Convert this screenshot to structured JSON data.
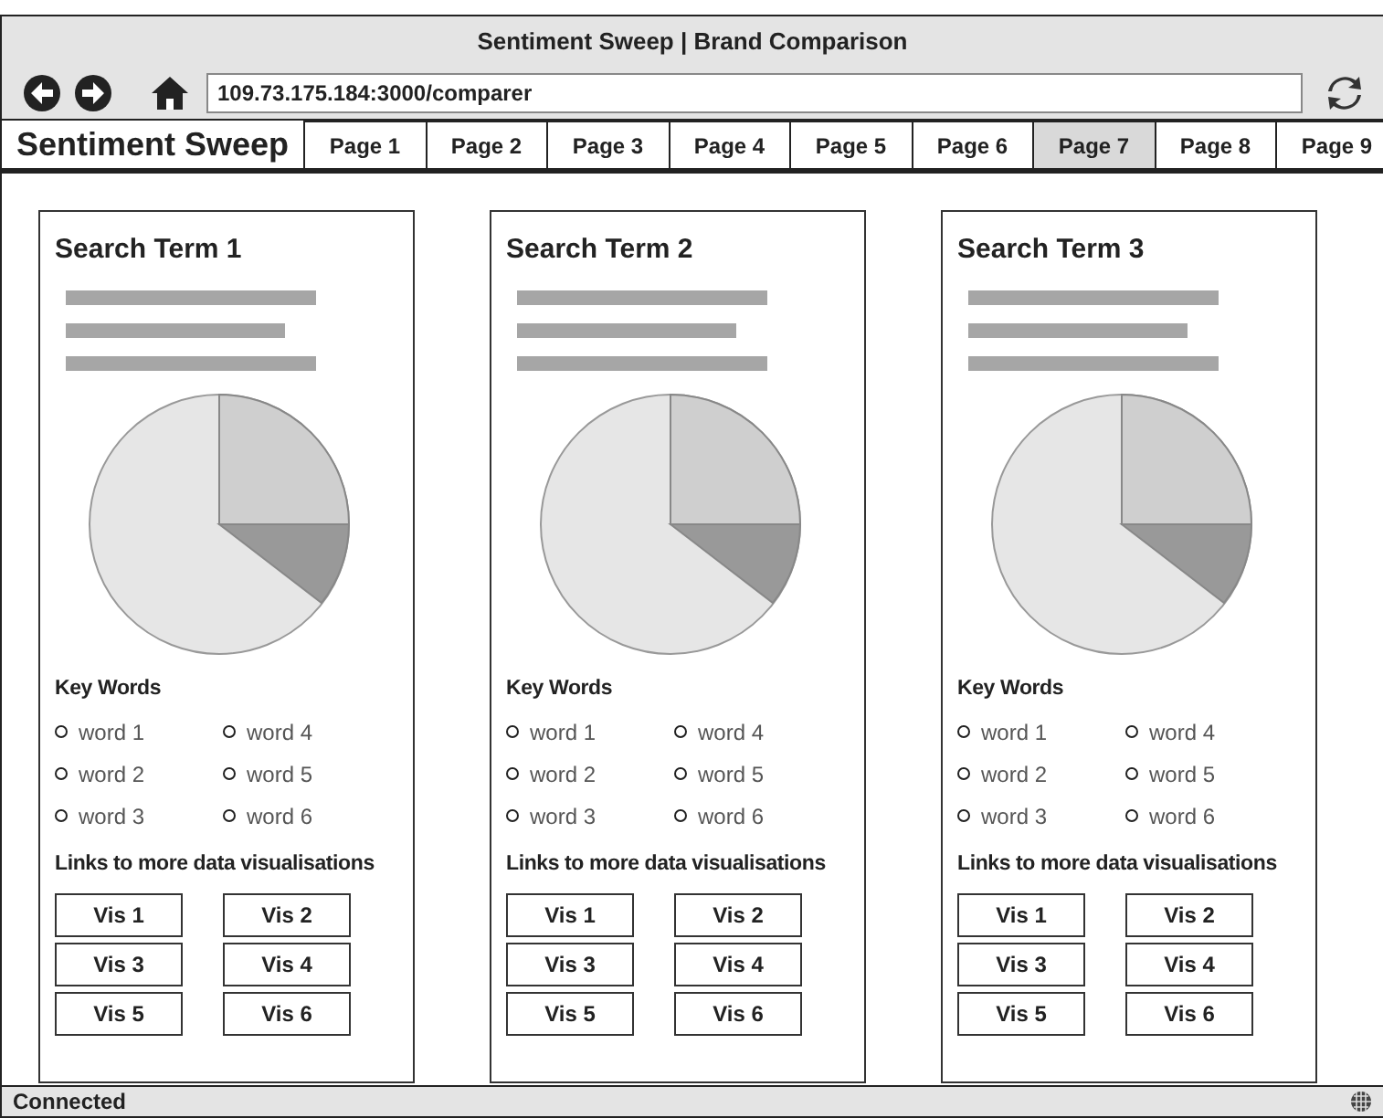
{
  "window": {
    "title": "Sentiment Sweep | Brand Comparison"
  },
  "address_bar": {
    "value": "109.73.175.184:3000/comparer"
  },
  "brand": "Sentiment Sweep",
  "tabs": [
    {
      "label": "Page 1",
      "selected": false
    },
    {
      "label": "Page 2",
      "selected": false
    },
    {
      "label": "Page 3",
      "selected": false
    },
    {
      "label": "Page 4",
      "selected": false
    },
    {
      "label": "Page 5",
      "selected": false
    },
    {
      "label": "Page 6",
      "selected": false
    },
    {
      "label": "Page 7",
      "selected": true
    },
    {
      "label": "Page 8",
      "selected": false
    },
    {
      "label": "Page 9",
      "selected": false
    }
  ],
  "cards": [
    {
      "title": "Search Term 1",
      "key_words_heading": "Key Words",
      "key_words": [
        "word 1",
        "word 2",
        "word 3",
        "word 4",
        "word 5",
        "word 6"
      ],
      "links_heading": "Links to more data visualisations",
      "links": [
        "Vis 1",
        "Vis 2",
        "Vis 3",
        "Vis 4",
        "Vis 5",
        "Vis 6"
      ]
    },
    {
      "title": "Search Term 2",
      "key_words_heading": "Key Words",
      "key_words": [
        "word 1",
        "word 2",
        "word 3",
        "word 4",
        "word 5",
        "word 6"
      ],
      "links_heading": "Links to more data visualisations",
      "links": [
        "Vis 1",
        "Vis 2",
        "Vis 3",
        "Vis 4",
        "Vis 5",
        "Vis 6"
      ]
    },
    {
      "title": "Search Term 3",
      "key_words_heading": "Key Words",
      "key_words": [
        "word 1",
        "word 2",
        "word 3",
        "word 4",
        "word 5",
        "word 6"
      ],
      "links_heading": "Links to more data visualisations",
      "links": [
        "Vis 1",
        "Vis 2",
        "Vis 3",
        "Vis 4",
        "Vis 5",
        "Vis 6"
      ]
    }
  ],
  "status_bar": {
    "text": "Connected"
  }
}
